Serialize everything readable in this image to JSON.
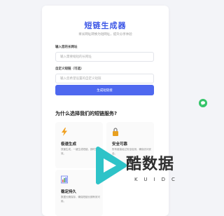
{
  "header": {
    "title": "短链生成器",
    "subtitle": "将长网址转换为短网址，提升分享体验"
  },
  "form": {
    "url_label": "输入您的长网址",
    "url_placeholder": "输入需要缩短的长网址",
    "alias_label": "自定义短链（可选）",
    "alias_placeholder": "输入您希望设置的自定义短链",
    "submit_label": "生成短链接"
  },
  "features": {
    "section_title": "为什么选择我们的短链服务?",
    "items": [
      {
        "title": "极速生成",
        "desc": "快速生成，一键生成短链，即时生效。",
        "icon": "lightning-icon"
      },
      {
        "title": "安全可靠",
        "desc": "所有链接经过安全检测，确保访问安全。",
        "icon": "lock-icon"
      },
      {
        "title": "稳定持久",
        "desc": "数据长期保存，确保短链长期有效可用。",
        "icon": "chart-icon"
      }
    ]
  },
  "watermark": {
    "text": "酷数据",
    "subtext": "KUIDC"
  },
  "colors": {
    "accent": "#4e68ef",
    "title": "#3b55e6",
    "badge": "#35c46a"
  }
}
